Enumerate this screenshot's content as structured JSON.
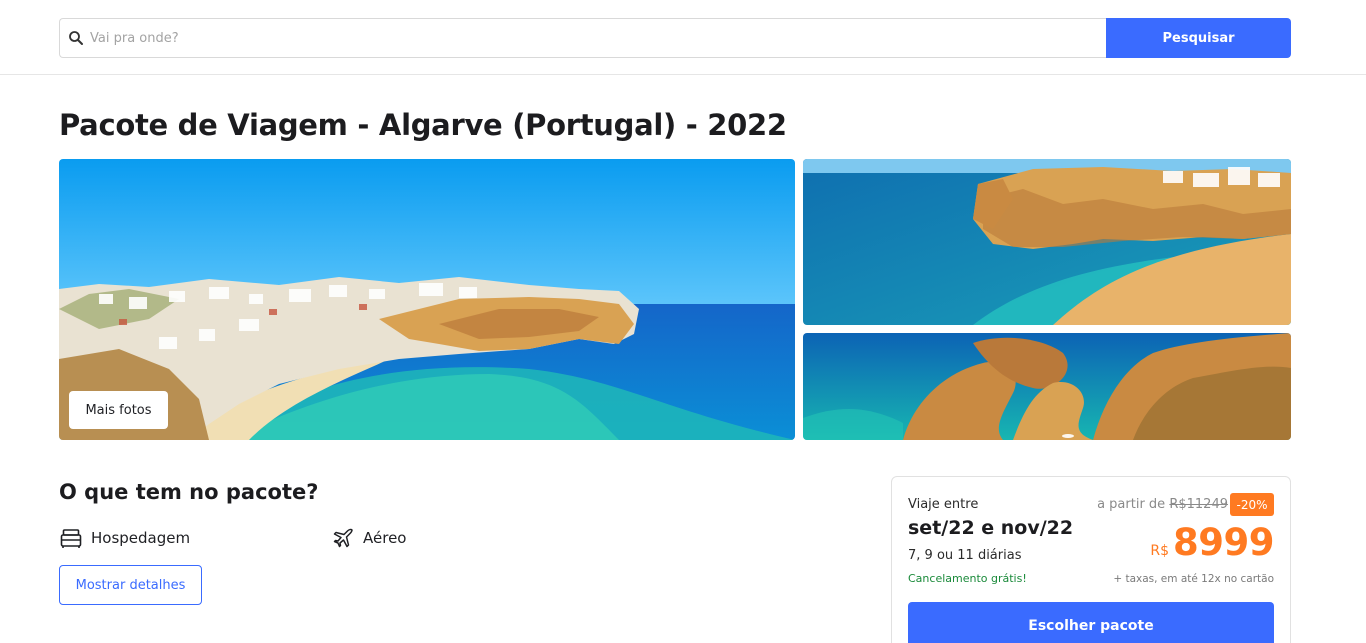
{
  "search": {
    "placeholder": "Vai pra onde?",
    "value": "",
    "button_label": "Pesquisar",
    "icon": "search-icon"
  },
  "page": {
    "title": "Pacote de Viagem - Algarve (Portugal) - 2022"
  },
  "gallery": {
    "more_photos_label": "Mais fotos",
    "images": [
      "beach-village-photo",
      "cliff-beach-photo",
      "rock-formations-photo"
    ]
  },
  "package": {
    "section_title": "O que tem no pacote?",
    "features": [
      {
        "label": "Hospedagem",
        "icon": "bed-icon"
      },
      {
        "label": "Aéreo",
        "icon": "airplane-icon"
      }
    ],
    "details_button": "Mostrar detalhes"
  },
  "pricing": {
    "travel_label": "Viaje entre",
    "travel_dates": "set/22 e nov/22",
    "nights": "7, 9 ou 11 diárias",
    "cancellation": "Cancelamento grátis!",
    "from_label": "a partir de",
    "old_price": "R$11249",
    "discount": "-20%",
    "currency": "R$",
    "price": "8999",
    "taxes_note": "+ taxas, em até 12x no cartão",
    "choose_button": "Escolher pacote"
  },
  "colors": {
    "primary": "#3a6bff",
    "accent": "#ff7a21",
    "success": "#1a8a3a"
  }
}
